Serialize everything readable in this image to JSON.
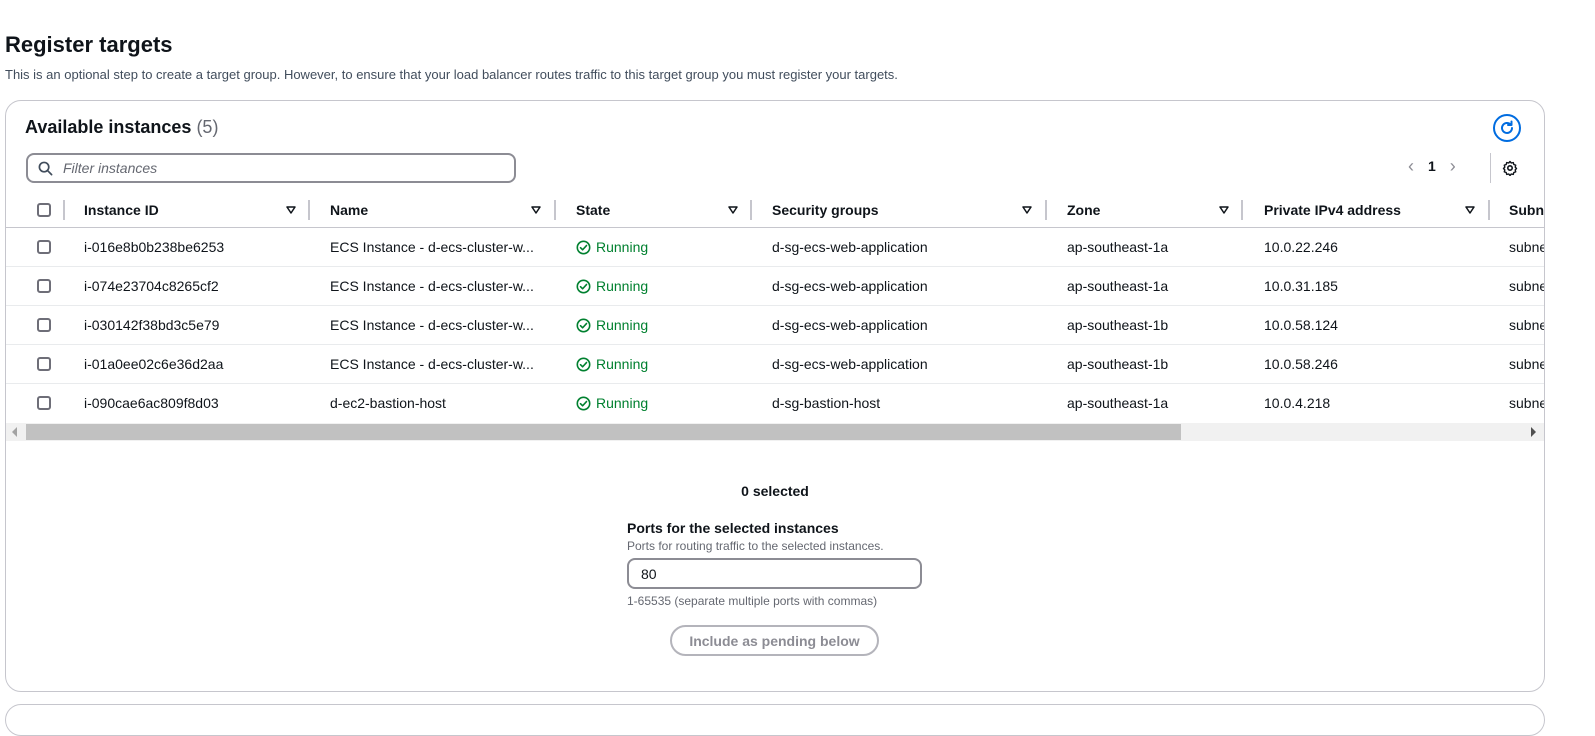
{
  "page": {
    "title": "Register targets",
    "description": "This is an optional step to create a target group. However, to ensure that your load balancer routes traffic to this target group you must register your targets."
  },
  "panel": {
    "title": "Available instances",
    "count": "(5)",
    "refresh_icon": "refresh-icon"
  },
  "filter": {
    "placeholder": "Filter instances",
    "icon": "search-icon"
  },
  "pagination": {
    "prev_icon": "chevron-left-icon",
    "page": "1",
    "next_icon": "chevron-right-icon",
    "settings_icon": "gear-icon"
  },
  "table": {
    "columns": [
      "Instance ID",
      "Name",
      "State",
      "Security groups",
      "Zone",
      "Private IPv4 address",
      "Subnet"
    ],
    "rows": [
      {
        "instance_id": "i-016e8b0b238be6253",
        "name": "ECS Instance - d-ecs-cluster-w...",
        "state": "Running",
        "security_groups": "d-sg-ecs-web-application",
        "zone": "ap-southeast-1a",
        "ip": "10.0.22.246",
        "subnet": "subnet"
      },
      {
        "instance_id": "i-074e23704c8265cf2",
        "name": "ECS Instance - d-ecs-cluster-w...",
        "state": "Running",
        "security_groups": "d-sg-ecs-web-application",
        "zone": "ap-southeast-1a",
        "ip": "10.0.31.185",
        "subnet": "subnet"
      },
      {
        "instance_id": "i-030142f38bd3c5e79",
        "name": "ECS Instance - d-ecs-cluster-w...",
        "state": "Running",
        "security_groups": "d-sg-ecs-web-application",
        "zone": "ap-southeast-1b",
        "ip": "10.0.58.124",
        "subnet": "subnet"
      },
      {
        "instance_id": "i-01a0ee02c6e36d2aa",
        "name": "ECS Instance - d-ecs-cluster-w...",
        "state": "Running",
        "security_groups": "d-sg-ecs-web-application",
        "zone": "ap-southeast-1b",
        "ip": "10.0.58.246",
        "subnet": "subnet"
      },
      {
        "instance_id": "i-090cae6ac809f8d03",
        "name": "d-ec2-bastion-host",
        "state": "Running",
        "security_groups": "d-sg-bastion-host",
        "zone": "ap-southeast-1a",
        "ip": "10.0.4.218",
        "subnet": "subnet"
      }
    ]
  },
  "selection": {
    "count_text": "0 selected",
    "ports_label": "Ports for the selected instances",
    "ports_description": "Ports for routing traffic to the selected instances.",
    "ports_value": "80",
    "ports_hint": "1-65535 (separate multiple ports with commas)",
    "include_button": "Include as pending below"
  },
  "colors": {
    "accent": "#006ce0",
    "success": "#00802f",
    "text": "#0f141a",
    "muted": "#656871",
    "border": "#c6c6cd"
  }
}
